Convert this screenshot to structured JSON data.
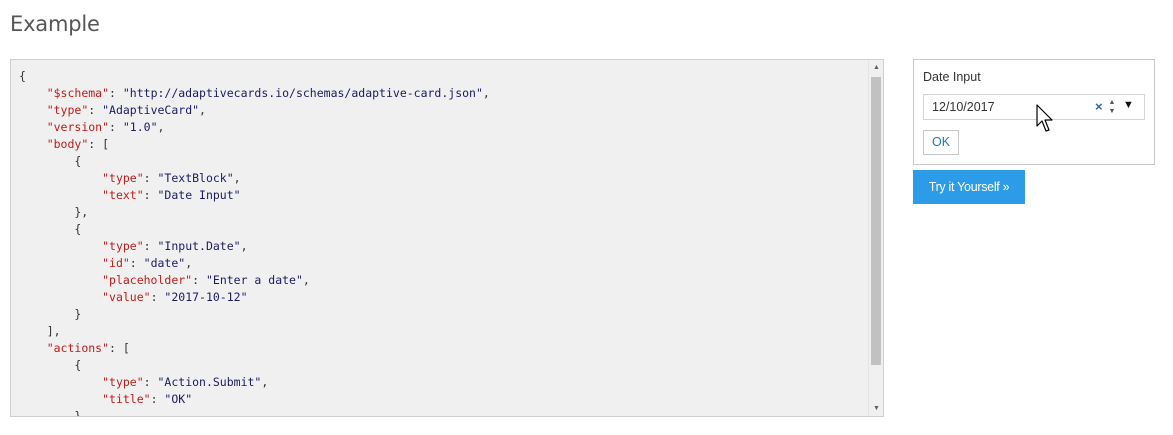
{
  "page": {
    "title": "Example"
  },
  "code_lines": [
    [
      {
        "t": "p",
        "v": "{"
      }
    ],
    [
      {
        "t": "p",
        "v": "    "
      },
      {
        "t": "k",
        "v": "\"$schema\""
      },
      {
        "t": "p",
        "v": ": "
      },
      {
        "t": "s",
        "v": "\"http://adaptivecards.io/schemas/adaptive-card.json\""
      },
      {
        "t": "p",
        "v": ","
      }
    ],
    [
      {
        "t": "p",
        "v": "    "
      },
      {
        "t": "k",
        "v": "\"type\""
      },
      {
        "t": "p",
        "v": ": "
      },
      {
        "t": "s",
        "v": "\"AdaptiveCard\""
      },
      {
        "t": "p",
        "v": ","
      }
    ],
    [
      {
        "t": "p",
        "v": "    "
      },
      {
        "t": "k",
        "v": "\"version\""
      },
      {
        "t": "p",
        "v": ": "
      },
      {
        "t": "s",
        "v": "\"1.0\""
      },
      {
        "t": "p",
        "v": ","
      }
    ],
    [
      {
        "t": "p",
        "v": "    "
      },
      {
        "t": "k",
        "v": "\"body\""
      },
      {
        "t": "p",
        "v": ": ["
      }
    ],
    [
      {
        "t": "p",
        "v": "        {"
      }
    ],
    [
      {
        "t": "p",
        "v": "            "
      },
      {
        "t": "k",
        "v": "\"type\""
      },
      {
        "t": "p",
        "v": ": "
      },
      {
        "t": "s",
        "v": "\"TextBlock\""
      },
      {
        "t": "p",
        "v": ","
      }
    ],
    [
      {
        "t": "p",
        "v": "            "
      },
      {
        "t": "k",
        "v": "\"text\""
      },
      {
        "t": "p",
        "v": ": "
      },
      {
        "t": "s",
        "v": "\"Date Input\""
      }
    ],
    [
      {
        "t": "p",
        "v": "        },"
      }
    ],
    [
      {
        "t": "p",
        "v": "        {"
      }
    ],
    [
      {
        "t": "p",
        "v": "            "
      },
      {
        "t": "k",
        "v": "\"type\""
      },
      {
        "t": "p",
        "v": ": "
      },
      {
        "t": "s",
        "v": "\"Input.Date\""
      },
      {
        "t": "p",
        "v": ","
      }
    ],
    [
      {
        "t": "p",
        "v": "            "
      },
      {
        "t": "k",
        "v": "\"id\""
      },
      {
        "t": "p",
        "v": ": "
      },
      {
        "t": "s",
        "v": "\"date\""
      },
      {
        "t": "p",
        "v": ","
      }
    ],
    [
      {
        "t": "p",
        "v": "            "
      },
      {
        "t": "k",
        "v": "\"placeholder\""
      },
      {
        "t": "p",
        "v": ": "
      },
      {
        "t": "s",
        "v": "\"Enter a date\""
      },
      {
        "t": "p",
        "v": ","
      }
    ],
    [
      {
        "t": "p",
        "v": "            "
      },
      {
        "t": "k",
        "v": "\"value\""
      },
      {
        "t": "p",
        "v": ": "
      },
      {
        "t": "s",
        "v": "\"2017-10-12\""
      }
    ],
    [
      {
        "t": "p",
        "v": "        }"
      }
    ],
    [
      {
        "t": "p",
        "v": "    ],"
      }
    ],
    [
      {
        "t": "p",
        "v": "    "
      },
      {
        "t": "k",
        "v": "\"actions\""
      },
      {
        "t": "p",
        "v": ": ["
      }
    ],
    [
      {
        "t": "p",
        "v": "        {"
      }
    ],
    [
      {
        "t": "p",
        "v": "            "
      },
      {
        "t": "k",
        "v": "\"type\""
      },
      {
        "t": "p",
        "v": ": "
      },
      {
        "t": "s",
        "v": "\"Action.Submit\""
      },
      {
        "t": "p",
        "v": ","
      }
    ],
    [
      {
        "t": "p",
        "v": "            "
      },
      {
        "t": "k",
        "v": "\"title\""
      },
      {
        "t": "p",
        "v": ": "
      },
      {
        "t": "s",
        "v": "\"OK\""
      }
    ],
    [
      {
        "t": "p",
        "v": "        }"
      }
    ]
  ],
  "card": {
    "label": "Date Input",
    "date_value": "12/10/2017",
    "clear_icon": "×",
    "spin_up": "▲",
    "spin_down": "▼",
    "dropdown_icon": "▼",
    "ok_label": "OK"
  },
  "try_button": {
    "label": "Try it Yourself »"
  },
  "colors": {
    "key": "#c41a16",
    "string": "#1a1a66",
    "accent": "#2c9be8",
    "link": "#1f78b4"
  },
  "icons": {
    "cursor": "mouse-pointer-icon",
    "scroll_up": "▲",
    "scroll_down": "▼"
  }
}
